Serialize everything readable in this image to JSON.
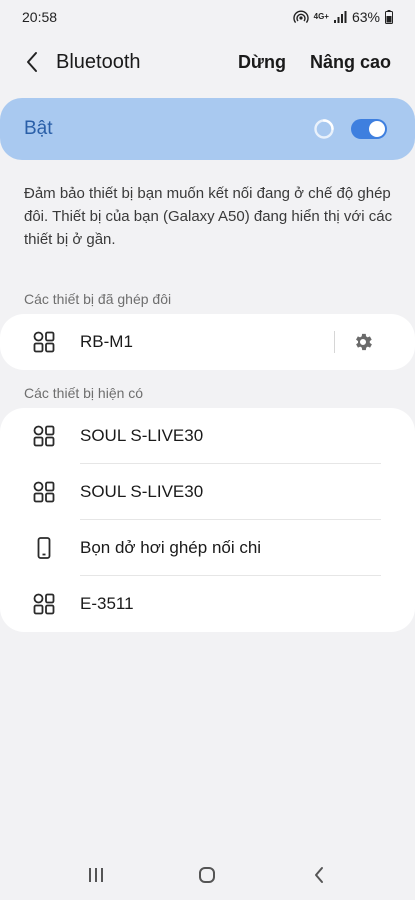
{
  "status_bar": {
    "time": "20:58",
    "network": "4G+",
    "battery": "63%",
    "icons": [
      "hotspot-icon",
      "signal-icon",
      "battery-icon"
    ]
  },
  "app_bar": {
    "title": "Bluetooth",
    "stop_label": "Dừng",
    "advanced_label": "Nâng cao"
  },
  "master_switch": {
    "label": "Bật",
    "on": true,
    "accent": "#3e7fdf",
    "background": "#a9c9f0"
  },
  "description": "Đảm bảo thiết bị bạn muốn kết nối đang ở chế độ ghép đôi. Thiết bị của bạn (Galaxy A50) đang hiển thị với các thiết bị ở gần.",
  "paired": {
    "header": "Các thiết bị đã ghép đôi",
    "devices": [
      {
        "name": "RB-M1",
        "icon": "generic-device-icon"
      }
    ]
  },
  "available": {
    "header": "Các thiết bị hiện có",
    "devices": [
      {
        "name": "SOUL S-LIVE30",
        "icon": "generic-device-icon"
      },
      {
        "name": "SOUL S-LIVE30",
        "icon": "generic-device-icon"
      },
      {
        "name": "Bọn dở hơi ghép nối chi",
        "icon": "phone-icon"
      },
      {
        "name": "E-3511",
        "icon": "generic-device-icon"
      }
    ]
  },
  "nav_bar": {
    "icons": [
      "recents-icon",
      "home-icon",
      "back-icon"
    ]
  }
}
